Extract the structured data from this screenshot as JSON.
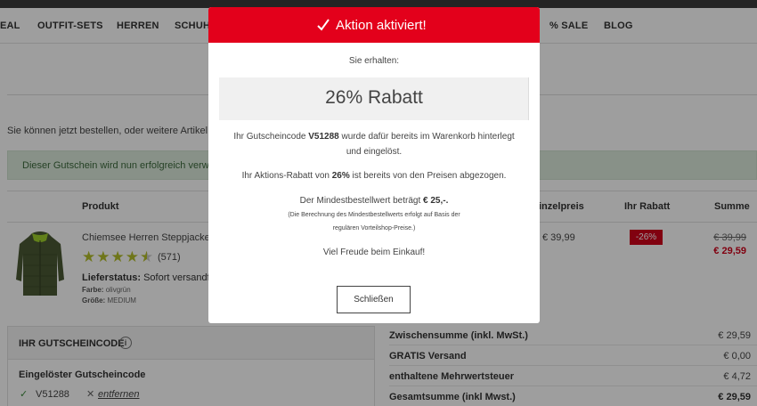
{
  "nav": {
    "items": [
      "EAL",
      "OUTFIT-SETS",
      "HERREN",
      "SCHUHE",
      "% SALE",
      "BLOG"
    ]
  },
  "page": {
    "info_text": "Sie können jetzt bestellen, oder weitere Artikel a",
    "success_message": "Dieser Gutschein wird nun erfolgreich verwer"
  },
  "table": {
    "headers": {
      "product": "Produkt",
      "unit_price": "inzelpreis",
      "discount": "Ihr Rabatt",
      "sum": "Summe"
    },
    "item": {
      "name": "Chiemsee Herren Steppjacke",
      "rating": 4.5,
      "rating_count": "(571)",
      "delivery_label": "Lieferstatus:",
      "delivery_value": "Sofort versandfe",
      "color_label": "Farbe:",
      "color_value": "olivgrün",
      "size_label": "Größe:",
      "size_value": "MEDIUM",
      "unit_price": "€ 39,99",
      "discount_badge": "-26%",
      "old_price": "€ 39,99",
      "new_price": "€ 29,59"
    }
  },
  "voucher": {
    "title": "IHR GUTSCHEINCODE",
    "info_icon_glyph": "i",
    "redeemed_label": "Eingelöster Gutscheincode",
    "check_glyph": "✓",
    "code": "V51288",
    "remove_glyph": "✕",
    "remove_label": "entfernen"
  },
  "summary": [
    {
      "label": "Zwischensumme (inkl. MwSt.)",
      "value": "€ 29,59",
      "bold": false
    },
    {
      "label": "GRATIS Versand",
      "value": "€ 0,00",
      "bold": false
    },
    {
      "label": "enthaltene Mehrwertsteuer",
      "value": "€ 4,72",
      "bold": false
    },
    {
      "label": "Gesamtsumme (inkl Mwst.)",
      "value": "€ 29,59",
      "bold": true
    }
  ],
  "modal": {
    "title": "Aktion aktiviert!",
    "received": "Sie erhalten:",
    "discount": "26% Rabatt",
    "voucher_pre": "Ihr Gutscheincode ",
    "voucher_code": "V51288",
    "voucher_post": " wurde dafür bereits im Warenkorb hinterlegt",
    "voucher_line2": "und eingelöst.",
    "action_pre": "Ihr Aktions-Rabatt von ",
    "action_pct": "26%",
    "action_post": " ist bereits von den Preisen abgezogen.",
    "min_pre": "Der Mindestbestellwert beträgt ",
    "min_value": "€ 25,-.",
    "calc_line1": "(Die Berechnung des Mindestbestellwerts erfolgt auf Basis der",
    "calc_line2": "regulären Vorteilshop-Preise.)",
    "enjoy": "Viel Freude beim Einkauf!",
    "close_label": "Schließen"
  },
  "colors": {
    "brand_red": "#e3001b",
    "rating_star": "#b4be2a",
    "success_bg": "#dcebdc"
  },
  "icons": [
    "check-icon",
    "star-icon",
    "info-icon",
    "close-x-icon",
    "jacket-image"
  ]
}
